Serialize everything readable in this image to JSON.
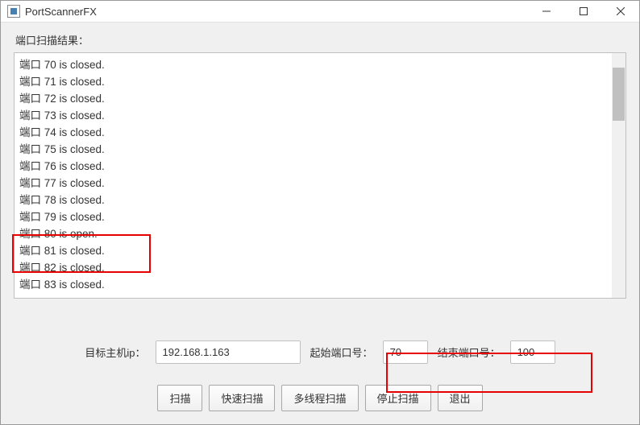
{
  "window": {
    "title": "PortScannerFX"
  },
  "labels": {
    "results_header": "端口扫描结果：",
    "host_label": "目标主机ip：",
    "start_port_label": "起始端口号：",
    "end_port_label": "结束端口号："
  },
  "inputs": {
    "host": "192.168.1.163",
    "start_port": "70",
    "end_port": "100"
  },
  "buttons": {
    "scan": "扫描",
    "fast_scan": "快速扫描",
    "multi_thread_scan": "多线程扫描",
    "stop_scan": "停止扫描",
    "exit": "退出"
  },
  "results": [
    "端口 70 is closed.",
    "端口 71 is closed.",
    "端口 72 is closed.",
    "端口 73 is closed.",
    "端口 74 is closed.",
    "端口 75 is closed.",
    "端口 76 is closed.",
    "端口 77 is closed.",
    "端口 78 is closed.",
    "端口 79 is closed.",
    "端口 80 is open.",
    "端口 81 is closed.",
    "端口 82 is closed.",
    "端口 83 is closed."
  ]
}
